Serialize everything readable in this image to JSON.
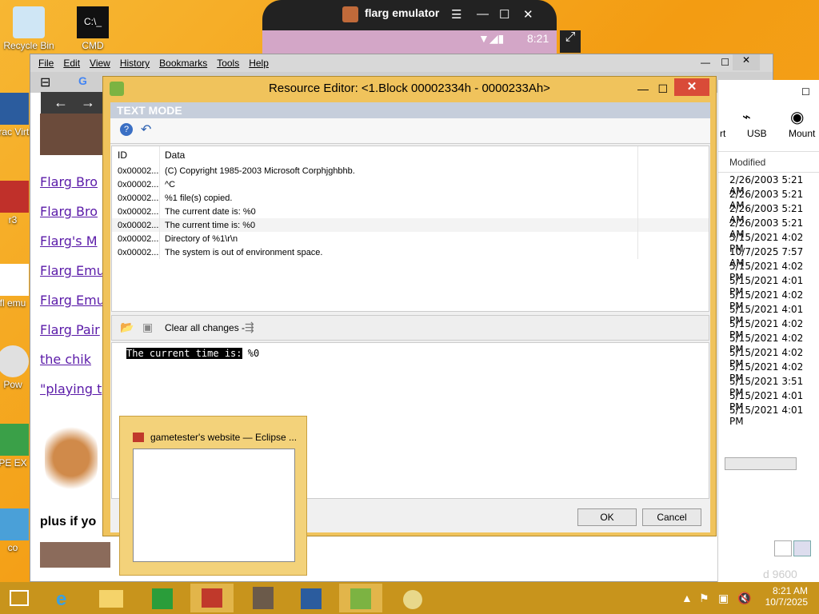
{
  "desktop": {
    "icons": [
      {
        "label": "Recycle Bin",
        "name": "recycle-bin"
      },
      {
        "label": "CMD",
        "name": "cmd"
      },
      {
        "label": "Orac Virtu",
        "name": "oracle-virtualbox"
      },
      {
        "label": "r3",
        "name": "r3"
      },
      {
        "label": "fl emu",
        "name": "flarg-emulator"
      },
      {
        "label": "Pow",
        "name": "power"
      },
      {
        "label": "PE EX",
        "name": "pe-explorer"
      },
      {
        "label": "co",
        "name": "co"
      }
    ]
  },
  "emulator": {
    "title": "flarg emulator",
    "time": "8:21"
  },
  "browser": {
    "menu": [
      "File",
      "Edit",
      "View",
      "History",
      "Bookmarks",
      "Tools",
      "Help"
    ],
    "links": [
      "Flarg Bro",
      "Flarg Bro",
      "Flarg's M",
      "Flarg Emu",
      "Flarg Emu",
      "Flarg Pair",
      "the chik",
      "\"playing t"
    ],
    "plus_text": "plus if yo"
  },
  "file_manager": {
    "toolbar": [
      "rt",
      "USB",
      "Mount"
    ],
    "column": "Modified",
    "rows": [
      "2/26/2003 5:21 AM",
      "2/26/2003 5:21 AM",
      "2/26/2003 5:21 AM",
      "2/26/2003 5:21 AM",
      "5/15/2021 4:02 PM",
      "10/7/2025 7:57 AM",
      "5/15/2021 4:02 PM",
      "5/15/2021 4:01 PM",
      "5/15/2021 4:02 PM",
      "5/15/2021 4:01 PM",
      "5/15/2021 4:02 PM",
      "5/15/2021 4:02 PM",
      "5/15/2021 4:02 PM",
      "5/15/2021 4:02 PM",
      "5/15/2021 3:51 PM",
      "5/15/2021 4:01 PM",
      "5/15/2021 4:01 PM"
    ],
    "status": "d 9600"
  },
  "dialog": {
    "title": "Resource Editor: <1.Block 00002334h - 0000233Ah>",
    "mode": "TEXT MODE",
    "columns": {
      "id": "ID",
      "data": "Data"
    },
    "rows": [
      {
        "id": "0x00002...",
        "data": "(C) Copyright 1985-2003 Microsoft Corphjghbhb."
      },
      {
        "id": "0x00002...",
        "data": "^C"
      },
      {
        "id": "0x00002...",
        "data": "%1 file(s) copied."
      },
      {
        "id": "0x00002...",
        "data": "The current date is: %0"
      },
      {
        "id": "0x00002...",
        "data": "The current time is: %0"
      },
      {
        "id": "0x00002...",
        "data": " Directory of %1\\r\\n"
      },
      {
        "id": "0x00002...",
        "data": "The system is out of environment space."
      }
    ],
    "clear_label": "Clear all changes -",
    "editor_highlight": "The current time is:",
    "editor_rest": " %0",
    "ok": "OK",
    "cancel": "Cancel"
  },
  "preview": {
    "title": "gametester's website — Eclipse ..."
  },
  "taskbar": {
    "time": "8:21 AM",
    "date": "10/7/2025"
  },
  "colors": {
    "desktop": "#f5a623",
    "dialog_frame": "#f0c35c",
    "close_red": "#d94b38",
    "link_purple": "#5a1aa8"
  }
}
